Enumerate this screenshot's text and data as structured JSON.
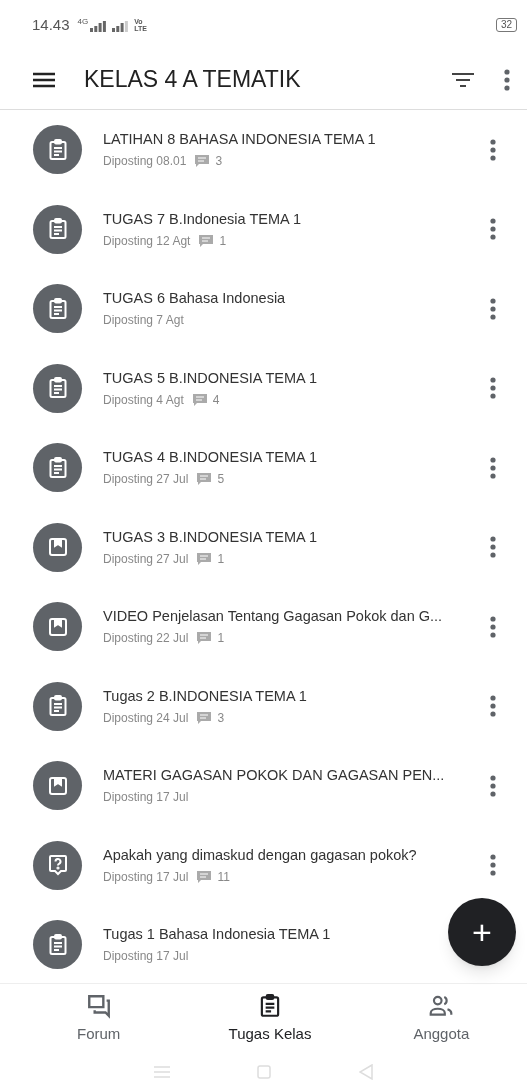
{
  "status_bar": {
    "time": "14.43",
    "network": "4G",
    "volte": [
      "Vo",
      "LTE"
    ],
    "battery": "32"
  },
  "app_bar": {
    "title": "KELAS 4 A TEMATIK"
  },
  "items": [
    {
      "kind": "assignment",
      "title": "LATIHAN 8 BAHASA INDONESIA TEMA 1",
      "posted": "Diposting 08.01",
      "comments": "3"
    },
    {
      "kind": "assignment",
      "title": "TUGAS 7 B.Indonesia TEMA 1",
      "posted": "Diposting 12 Agt",
      "comments": "1"
    },
    {
      "kind": "assignment",
      "title": "TUGAS 6 Bahasa Indonesia",
      "posted": "Diposting 7 Agt"
    },
    {
      "kind": "assignment",
      "title": "TUGAS 5 B.INDONESIA TEMA 1",
      "posted": "Diposting 4 Agt",
      "comments": "4"
    },
    {
      "kind": "assignment",
      "title": "TUGAS 4 B.INDONESIA TEMA 1",
      "posted": "Diposting 27 Jul",
      "comments": "5"
    },
    {
      "kind": "material",
      "title": "TUGAS 3 B.INDONESIA TEMA 1",
      "posted": "Diposting 27 Jul",
      "comments": "1"
    },
    {
      "kind": "material",
      "title": "VIDEO Penjelasan Tentang Gagasan Pokok dan G...",
      "posted": "Diposting 22 Jul",
      "comments": "1"
    },
    {
      "kind": "assignment",
      "title": "Tugas 2 B.INDONESIA TEMA 1",
      "posted": "Diposting 24 Jul",
      "comments": "3"
    },
    {
      "kind": "material",
      "title": "MATERI GAGASAN POKOK DAN GAGASAN PEN...",
      "posted": "Diposting 17 Jul"
    },
    {
      "kind": "question",
      "title": "Apakah yang dimaskud dengan gagasan pokok?",
      "posted": "Diposting 17 Jul",
      "comments": "11"
    },
    {
      "kind": "assignment",
      "title": "Tugas 1 Bahasa Indonesia TEMA 1",
      "posted": "Diposting 17 Jul"
    }
  ],
  "fab": {
    "label": "+"
  },
  "bottom_nav": [
    {
      "kind": "forum",
      "label": "Forum",
      "selected": false
    },
    {
      "kind": "classwork",
      "label": "Tugas Kelas",
      "selected": true
    },
    {
      "kind": "people",
      "label": "Anggota",
      "selected": false
    }
  ]
}
